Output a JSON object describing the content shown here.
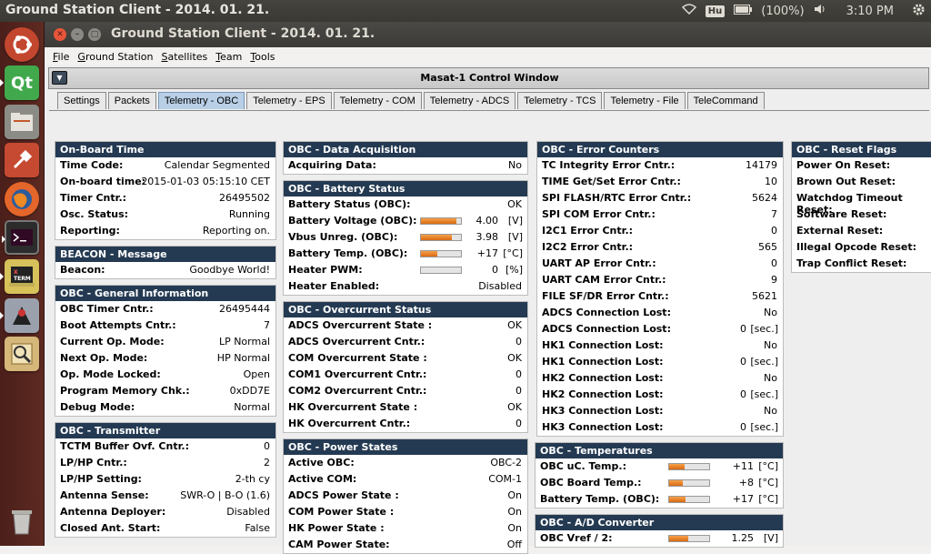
{
  "top_panel": {
    "title": "Ground Station Client - 2014. 01. 21.",
    "keyboard": "Hu",
    "battery": "(100%)",
    "time": "3:10 PM"
  },
  "launcher": {
    "items": [
      "ubuntu-dash",
      "qt-creator",
      "file-manager",
      "system-settings",
      "firefox",
      "terminal",
      "xterm",
      "java-app",
      "image-viewer",
      "trash"
    ]
  },
  "window": {
    "title": "Ground Station Client - 2014. 01. 21.",
    "menu": [
      "File",
      "Ground Station",
      "Satellites",
      "Team",
      "Tools"
    ],
    "control_title": "Masat-1 Control Window",
    "tabs": [
      "Settings",
      "Packets",
      "Telemetry - OBC",
      "Telemetry - EPS",
      "Telemetry - COM",
      "Telemetry - ADCS",
      "Telemetry - TCS",
      "Telemetry - File",
      "TeleCommand"
    ],
    "active_tab": "Telemetry - OBC"
  },
  "panels": {
    "onboard_time": {
      "title": "On-Board Time",
      "rows": [
        {
          "label": "Time Code:",
          "value": "Calendar Segmented"
        },
        {
          "label": "On-board time:",
          "value": "2015-01-03 05:15:10 CET"
        },
        {
          "label": "Timer Cntr.:",
          "value": "26495502"
        },
        {
          "label": "Osc. Status:",
          "value": "Running"
        },
        {
          "label": "Reporting:",
          "value": "Reporting on."
        }
      ]
    },
    "beacon": {
      "title": "BEACON - Message",
      "rows": [
        {
          "label": "Beacon:",
          "value": "Goodbye World!"
        }
      ]
    },
    "general": {
      "title": "OBC - General Information",
      "rows": [
        {
          "label": "OBC Timer Cntr.:",
          "value": "26495444"
        },
        {
          "label": "Boot Attempts Cntr.:",
          "value": "7"
        },
        {
          "label": "Current Op. Mode:",
          "value": "LP Normal"
        },
        {
          "label": "Next Op. Mode:",
          "value": "HP Normal"
        },
        {
          "label": "Op. Mode Locked:",
          "value": "Open"
        },
        {
          "label": "Program Memory Chk.:",
          "value": "0xDD7E"
        },
        {
          "label": "Debug Mode:",
          "value": "Normal"
        }
      ]
    },
    "transmitter": {
      "title": "OBC - Transmitter",
      "rows": [
        {
          "label": "TCTM Buffer Ovf. Cntr.:",
          "value": "0"
        },
        {
          "label": "LP/HP Cntr.:",
          "value": "2"
        },
        {
          "label": "LP/HP Setting:",
          "value": "2-th cy"
        },
        {
          "label": "Antenna Sense:",
          "value": "SWR-O | B-O (1.6)"
        },
        {
          "label": "Antenna Deployer:",
          "value": "Disabled"
        },
        {
          "label": "Closed Ant. Start:",
          "value": "False"
        }
      ]
    },
    "data_acq": {
      "title": "OBC - Data Acquisition",
      "rows": [
        {
          "label": "Acquiring Data:",
          "value": "No"
        }
      ]
    },
    "battery": {
      "title": "OBC - Battery Status",
      "rows": [
        {
          "label": "Battery Status (OBC):",
          "value": "OK"
        },
        {
          "label": "Battery Voltage (OBC):",
          "value": "4.00",
          "unit": "[V]",
          "bar": 0.88
        },
        {
          "label": "Vbus Unreg. (OBC):",
          "value": "3.98",
          "unit": "[V]",
          "bar": 0.78
        },
        {
          "label": "Battery Temp. (OBC):",
          "value": "+17",
          "unit": "[°C]",
          "bar": 0.42
        },
        {
          "label": "Heater PWM:",
          "value": "0",
          "unit": "[%]",
          "bar": 0
        },
        {
          "label": "Heater Enabled:",
          "value": "Disabled"
        }
      ]
    },
    "overcurrent": {
      "title": "OBC - Overcurrent Status",
      "rows": [
        {
          "label": "ADCS Overcurrent State :",
          "value": "OK"
        },
        {
          "label": "ADCS Overcurrent Cntr.:",
          "value": "0"
        },
        {
          "label": "COM Overcurrent State :",
          "value": "OK"
        },
        {
          "label": "COM1 Overcurrent Cntr.:",
          "value": "0"
        },
        {
          "label": "COM2 Overcurrent Cntr.:",
          "value": "0"
        },
        {
          "label": "HK Overcurrent State :",
          "value": "OK"
        },
        {
          "label": "HK Overcurrent Cntr.:",
          "value": "0"
        }
      ]
    },
    "power": {
      "title": "OBC - Power States",
      "rows": [
        {
          "label": "Active OBC:",
          "value": "OBC-2"
        },
        {
          "label": "Active COM:",
          "value": "COM-1"
        },
        {
          "label": "ADCS Power State :",
          "value": "On"
        },
        {
          "label": "COM Power State :",
          "value": "On"
        },
        {
          "label": "HK Power State :",
          "value": "On"
        },
        {
          "label": "CAM Power State:",
          "value": "Off"
        }
      ]
    },
    "errors": {
      "title": "OBC - Error Counters",
      "rows": [
        {
          "label": "TC Integrity Error Cntr.:",
          "value": "14179"
        },
        {
          "label": "TIME Get/Set Error Cntr.:",
          "value": "10"
        },
        {
          "label": "SPI FLASH/RTC Error Cntr.:",
          "value": "5624"
        },
        {
          "label": "SPI COM Error Cntr.:",
          "value": "7"
        },
        {
          "label": "I2C1 Error Cntr.:",
          "value": "0"
        },
        {
          "label": "I2C2 Error Cntr.:",
          "value": "565"
        },
        {
          "label": "UART AP Error Cntr.:",
          "value": "0"
        },
        {
          "label": "UART CAM Error Cntr.:",
          "value": "9"
        },
        {
          "label": "FILE SF/DR Error Cntr.:",
          "value": "5621"
        },
        {
          "label": "ADCS Connection Lost:",
          "value": "No"
        },
        {
          "label": "ADCS Connection Lost:",
          "value": "0",
          "unit": "[sec.]"
        },
        {
          "label": "HK1 Connection Lost:",
          "value": "No"
        },
        {
          "label": "HK1 Connection Lost:",
          "value": "0",
          "unit": "[sec.]"
        },
        {
          "label": "HK2 Connection Lost:",
          "value": "No"
        },
        {
          "label": "HK2 Connection Lost:",
          "value": "0",
          "unit": "[sec.]"
        },
        {
          "label": "HK3 Connection Lost:",
          "value": "No"
        },
        {
          "label": "HK3 Connection Lost:",
          "value": "0",
          "unit": "[sec.]"
        }
      ]
    },
    "temps": {
      "title": "OBC - Temperatures",
      "rows": [
        {
          "label": "OBC uC. Temp.:",
          "value": "+11",
          "unit": "[°C]",
          "bar": 0.38
        },
        {
          "label": "OBC Board Temp.:",
          "value": "+8",
          "unit": "[°C]",
          "bar": 0.35
        },
        {
          "label": "Battery Temp. (OBC):",
          "value": "+17",
          "unit": "[°C]",
          "bar": 0.42
        }
      ]
    },
    "adc": {
      "title": "OBC - A/D Converter",
      "rows": [
        {
          "label": "OBC Vref / 2:",
          "value": "1.25",
          "unit": "[V]",
          "bar": 0.48
        }
      ]
    },
    "reset": {
      "title": "OBC - Reset Flags",
      "rows": [
        {
          "label": "Power On Reset:",
          "value": ""
        },
        {
          "label": "Brown Out Reset:",
          "value": ""
        },
        {
          "label": "Watchdog Timeout Reset:",
          "value": ""
        },
        {
          "label": "Software Reset:",
          "value": ""
        },
        {
          "label": "External Reset:",
          "value": ""
        },
        {
          "label": "Illegal Opcode Reset:",
          "value": ""
        },
        {
          "label": "Trap Conflict Reset:",
          "value": ""
        }
      ]
    }
  },
  "colors": {
    "panel_header": "#243a52",
    "bar_fill": "#e8832a",
    "launcher": "#5e2a22",
    "active_tab": "#b8cfe6"
  }
}
